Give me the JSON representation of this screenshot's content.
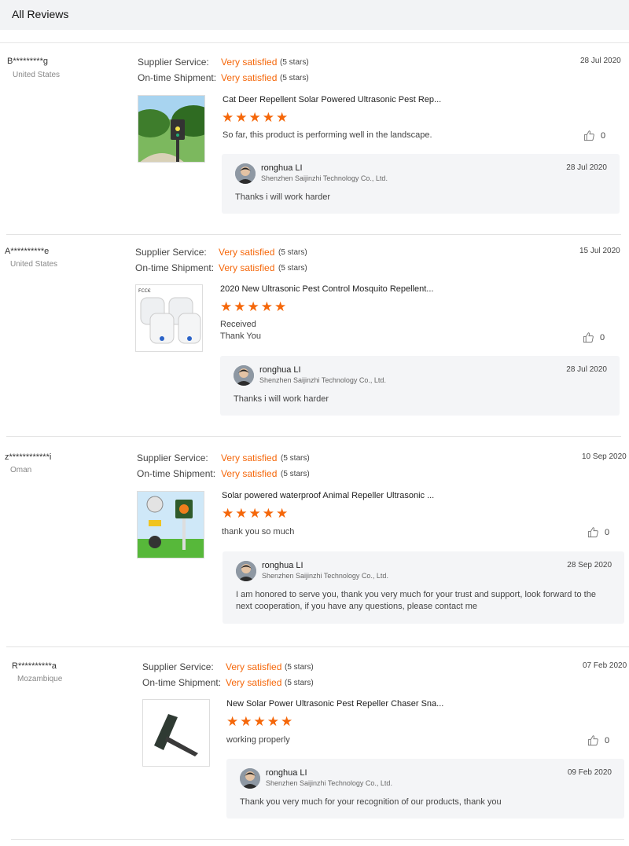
{
  "header": {
    "title": "All Reviews"
  },
  "labels": {
    "supplier_service": "Supplier Service:",
    "on_time_shipment": "On-time Shipment:",
    "like_count_default": "0"
  },
  "reviews": [
    {
      "reviewer": "B*********g",
      "country": "United States",
      "supplier_rating": "Very satisfied",
      "supplier_stars": "(5 stars)",
      "shipment_rating": "Very satisfied",
      "shipment_stars": "(5 stars)",
      "date": "28 Jul 2020",
      "product_title": "Cat Deer Repellent Solar Powered Ultrasonic Pest Rep...",
      "comment": "So far, this product is performing well in the landscape.",
      "likes": "0",
      "reply": {
        "name": "ronghua LI",
        "company": "Shenzhen Saijinzhi Technology Co., Ltd.",
        "date": "28 Jul 2020",
        "text": "Thanks i will work harder"
      }
    },
    {
      "reviewer": "A**********e",
      "country": "United States",
      "supplier_rating": "Very satisfied",
      "supplier_stars": "(5 stars)",
      "shipment_rating": "Very satisfied",
      "shipment_stars": "(5 stars)",
      "date": "15 Jul 2020",
      "product_title": "2020 New Ultrasonic Pest Control Mosquito Repellent...",
      "comment_line1": "Received",
      "comment_line2": "Thank You",
      "likes": "0",
      "reply": {
        "name": "ronghua LI",
        "company": "Shenzhen Saijinzhi Technology Co., Ltd.",
        "date": "28 Jul 2020",
        "text": "Thanks i will work harder"
      }
    },
    {
      "reviewer": "z************i",
      "country": "Oman",
      "supplier_rating": "Very satisfied",
      "supplier_stars": "(5 stars)",
      "shipment_rating": "Very satisfied",
      "shipment_stars": "(5 stars)",
      "date": "10 Sep 2020",
      "product_title": "Solar powered waterproof Animal Repeller Ultrasonic ...",
      "comment": "thank you so much",
      "likes": "0",
      "reply": {
        "name": "ronghua LI",
        "company": "Shenzhen Saijinzhi Technology Co., Ltd.",
        "date": "28 Sep 2020",
        "text": "I am honored to serve you, thank you very much for your trust and support, look forward to the next cooperation, if you have any questions, please contact me"
      }
    },
    {
      "reviewer": "R**********a",
      "country": "Mozambique",
      "supplier_rating": "Very satisfied",
      "supplier_stars": "(5 stars)",
      "shipment_rating": "Very satisfied",
      "shipment_stars": "(5 stars)",
      "date": "07 Feb 2020",
      "product_title": "New Solar Power Ultrasonic Pest Repeller Chaser Sna...",
      "comment": "working properly",
      "likes": "0",
      "reply": {
        "name": "ronghua LI",
        "company": "Shenzhen Saijinzhi Technology Co., Ltd.",
        "date": "09 Feb 2020",
        "text": "Thank you very much for your recognition of our products, thank you"
      }
    }
  ],
  "colors": {
    "accent": "#f5670a",
    "header_bg": "#f2f3f5",
    "reply_bg": "#f4f5f7"
  },
  "icons": {
    "like": "thumbs-up-icon",
    "star": "star-icon"
  }
}
